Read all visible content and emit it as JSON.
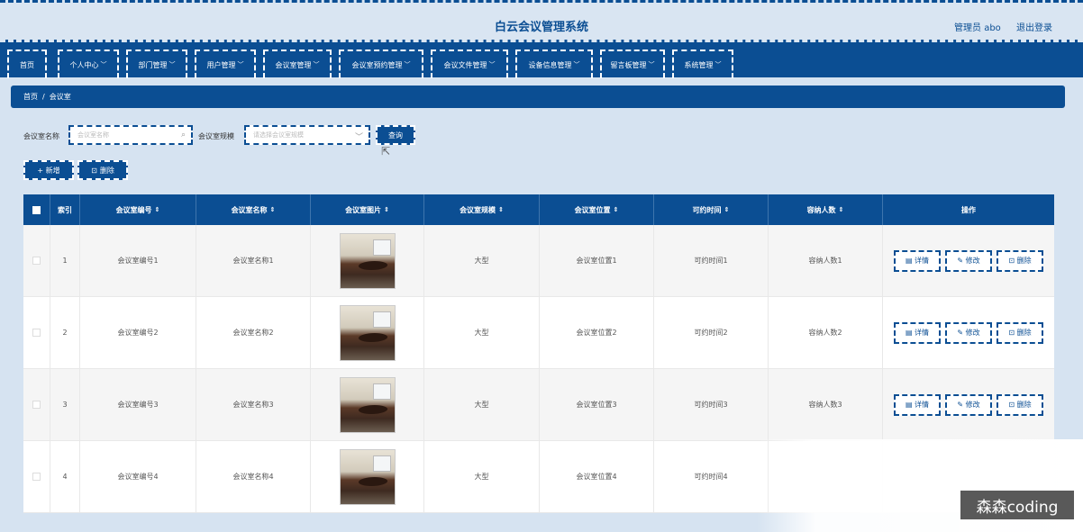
{
  "header": {
    "title": "白云会议管理系统",
    "user": "管理员 abo",
    "logout": "退出登录"
  },
  "nav": [
    {
      "label": "首页",
      "has_menu": false
    },
    {
      "label": "个人中心",
      "has_menu": true
    },
    {
      "label": "部门管理",
      "has_menu": true
    },
    {
      "label": "用户管理",
      "has_menu": true
    },
    {
      "label": "会议室管理",
      "has_menu": true
    },
    {
      "label": "会议室预约管理",
      "has_menu": true
    },
    {
      "label": "会议文件管理",
      "has_menu": true
    },
    {
      "label": "设备信息管理",
      "has_menu": true
    },
    {
      "label": "留言板管理",
      "has_menu": true
    },
    {
      "label": "系统管理",
      "has_menu": true
    }
  ],
  "breadcrumb": {
    "home": "首页",
    "sep": "/",
    "current": "会议室"
  },
  "search": {
    "name_label": "会议室名称",
    "name_placeholder": "会议室名称",
    "scale_label": "会议室规模",
    "scale_placeholder": "请选择会议室规模",
    "query_button": "查询"
  },
  "actions": {
    "add": "+ 新增",
    "delete": "删除"
  },
  "table": {
    "columns": [
      "索引",
      "会议室编号",
      "会议室名称",
      "会议室图片",
      "会议室规模",
      "会议室位置",
      "可约时间",
      "容纳人数",
      "操作"
    ],
    "rows": [
      {
        "index": "1",
        "number": "会议室编号1",
        "name": "会议室名称1",
        "scale": "大型",
        "location": "会议室位置1",
        "time": "可约时间1",
        "capacity": "容纳人数1"
      },
      {
        "index": "2",
        "number": "会议室编号2",
        "name": "会议室名称2",
        "scale": "大型",
        "location": "会议室位置2",
        "time": "可约时间2",
        "capacity": "容纳人数2"
      },
      {
        "index": "3",
        "number": "会议室编号3",
        "name": "会议室名称3",
        "scale": "大型",
        "location": "会议室位置3",
        "time": "可约时间3",
        "capacity": "容纳人数3"
      },
      {
        "index": "4",
        "number": "会议室编号4",
        "name": "会议室名称4",
        "scale": "大型",
        "location": "会议室位置4",
        "time": "可约时间4",
        "capacity": ""
      }
    ],
    "ops": {
      "detail": "详情",
      "edit": "修改",
      "delete": "删除"
    }
  },
  "watermark": "森森coding",
  "colors": {
    "primary": "#0b4e93",
    "background": "#d6e3f1"
  }
}
